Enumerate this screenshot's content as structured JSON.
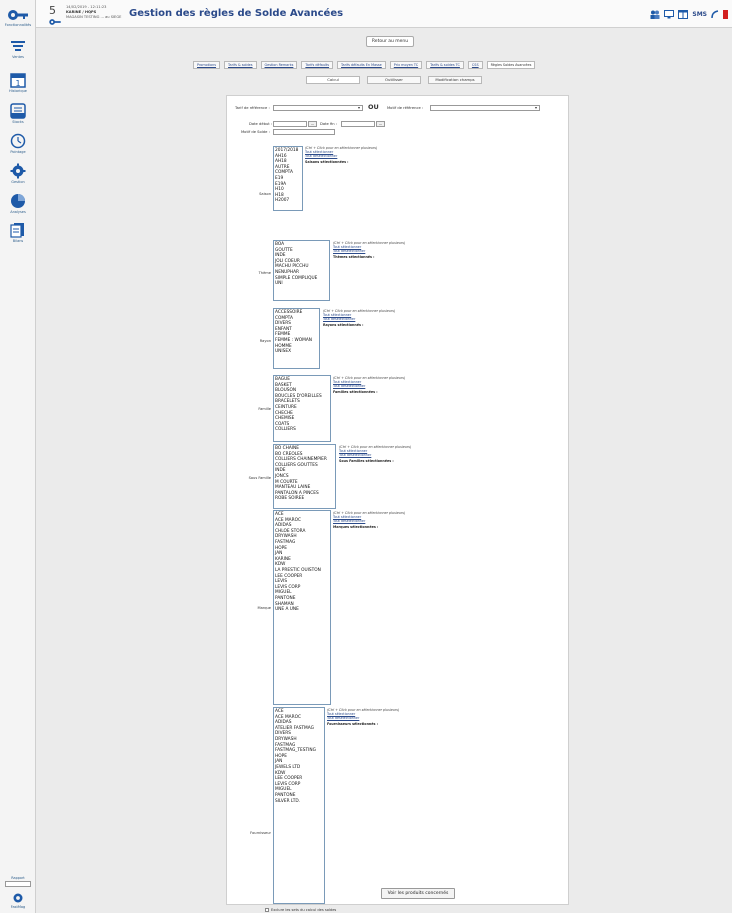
{
  "header": {
    "day": "5",
    "datetime": "14/02/2019 - 12:11:23",
    "user": "KARINE / HQPS",
    "store": "MAGASIN TESTING ... au SIEGE",
    "title": "Gestion des règles de Solde Avancées",
    "sms_label": "SMS"
  },
  "sidebar": {
    "items": [
      {
        "label": "Fonctionnalités",
        "icon": "key-icon"
      },
      {
        "label": "Ventes",
        "icon": "cart-icon"
      },
      {
        "label": "Historique",
        "icon": "calendar-icon"
      },
      {
        "label": "Stocks",
        "icon": "inbox-icon"
      },
      {
        "label": "Pointage",
        "icon": "clock-icon"
      },
      {
        "label": "Gestion",
        "icon": "gear-icon"
      },
      {
        "label": "Analyses",
        "icon": "pie-chart-icon"
      },
      {
        "label": "Bilans",
        "icon": "document-icon"
      }
    ],
    "search_label": "Rapport",
    "bottom_label": "FastMag"
  },
  "retour_label": "Retour au menu",
  "main_tabs": [
    {
      "label": "Promotions",
      "active": false
    },
    {
      "label": "Tarifs & soldes",
      "active": false
    },
    {
      "label": "Gestion Remarks",
      "active": false
    },
    {
      "label": "Tarifs défaults",
      "active": false
    },
    {
      "label": "Tarifs défaults En Masse",
      "active": false
    },
    {
      "label": "Prix moyen TC",
      "active": false
    },
    {
      "label": "Tarifs & soldes TC",
      "active": false
    },
    {
      "label": "CSS",
      "active": false
    },
    {
      "label": "Règles Soldes Avancées",
      "active": true
    }
  ],
  "sub_tabs": [
    {
      "label": "Calcul",
      "active": true
    },
    {
      "label": "Outilisser",
      "active": false
    },
    {
      "label": "Modification champs",
      "active": false
    }
  ],
  "form": {
    "tarif_ref_label": "Tarif de référence :",
    "ou_label": "OU",
    "motif_ref_label": "Motif de référence :",
    "date_debut_label": "Date début :",
    "date_fin_label": "Date fin :",
    "motif_solde_label": "Motif de Solde :",
    "dots": "..."
  },
  "helper_text": {
    "ctrl": "(Ctrl + Click pour en sélectionner plusieurs)",
    "select_all": "Tout sélectionner",
    "deselect_all": "Tout désélectionner"
  },
  "filters": [
    {
      "label": "Saison",
      "selected_header": "Saisons sélectionnées :",
      "options": [
        "2017/2018",
        "AH16",
        "AH18",
        "AUTRE",
        "COMPTA",
        "E19",
        "E19A",
        "H10",
        "H18",
        "H2007"
      ]
    },
    {
      "label": "Thème",
      "selected_header": "Thèmes sélectionnés :",
      "options": [
        "BOA",
        "GOUTTE",
        "INDE",
        "JOLI COEUR",
        "MACHU PICCHU",
        "NENUPHAR",
        "SIMPLE COMPLIQUE",
        "UNI"
      ]
    },
    {
      "label": "Rayon",
      "selected_header": "Rayons sélectionnés :",
      "options": [
        "ACCESSOIRE",
        "COMPTA",
        "DIVERS",
        "ENFANT",
        "FEMME",
        "FEMME : WOMAN",
        "HOMME",
        "UNISEX"
      ]
    },
    {
      "label": "Famille",
      "selected_header": "Familles sélectionnées :",
      "options": [
        "BAGUE",
        "BASKET",
        "BLOUSON",
        "BOUCLES D'OREILLES",
        "BRACELETS",
        "CEINTURE",
        "CHECHE",
        "CHEMISE",
        "COATS",
        "COLLIERS"
      ]
    },
    {
      "label": "Sous Famille",
      "selected_header": "Sous Familles sélectionnées :",
      "options": [
        "BO CHAINE",
        "BO CREOLES",
        "COLLIERS CHAINEMPIER",
        "COLLIERS GOUTTES",
        "INDE",
        "JONCS",
        "M COURTE",
        "MANTEAU LAINE",
        "PANTALON A PINCES",
        "ROBE SOIREE"
      ]
    },
    {
      "label": "Marque",
      "selected_header": "Marques sélectionnées :",
      "options": [
        "ACE",
        "ACE MAROC",
        "ADIDAS",
        "CHLOE STORA",
        "DRYWASH",
        "FASTMAG",
        "HOPE",
        "JAN",
        "KARINE",
        "KDW",
        "LA PRESTIC OUISTON",
        "LEE COOPER",
        "LEVIS",
        "LEVIS CORP",
        "MIGUEL",
        "PANTONE",
        "SHAMAN",
        "UNE A UNE"
      ]
    },
    {
      "label": "Fournisseur",
      "selected_header": "Fournisseurs sélectionnés :",
      "options": [
        "ACE",
        "ACE MAROC",
        "ADIDAS",
        "ATELIER FASTMAG",
        "DIVERS",
        "DRYWASH",
        "FASTMAG",
        "FASTMAG_TESTING",
        "HOPE",
        "JAN",
        "JEWELS LTD",
        "KDW",
        "LEE COOPER",
        "LEVIS CORP",
        "MIGUEL",
        "PANTONE",
        "SILVER LTD."
      ]
    }
  ],
  "exclude_label": "Exclure les sets du calcul des soldes",
  "submit_label": "Voir les produits concernés"
}
